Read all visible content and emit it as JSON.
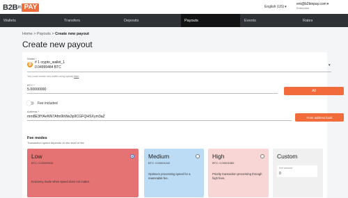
{
  "header": {
    "logo_text": "B2B",
    "logo_sub": "in",
    "logo_pay": "PAY",
    "language": "English (US)",
    "user_email": "ent@b2binpay.com",
    "user_role": "Enterprise"
  },
  "nav": {
    "items": [
      "Wallets",
      "Transfers",
      "Deposits",
      "Payouts",
      "Events",
      "Rates"
    ],
    "active": "Payouts"
  },
  "breadcrumb": {
    "home": "Home",
    "sep": ">",
    "payouts": "Payouts",
    "current": "Create new payout"
  },
  "page": {
    "title": "Create new payout"
  },
  "form": {
    "wallet_label": "Wallet *",
    "wallet_name": "# 1 crypto_wallet_1",
    "wallet_balance": "0.04999484 BTC",
    "wallet_hint": "You could create new wallet using special",
    "wallet_hint_link": "form",
    "amount_label": "BTC *",
    "amount_value": "5.00000000",
    "all_button": "All",
    "fee_included": "Fee included",
    "address_label": "Address *",
    "address_value": "mm8E3fYAeNN7Afm9bWa3p9CGFQHSXym3aZ",
    "address_book_button": "From address book"
  },
  "fee_modes": {
    "title": "Fee modes",
    "subtitle": "Transaction speed depends on the level of fee",
    "modes": [
      {
        "name": "Low",
        "fee": "BTC: 0.00000516",
        "desc": "Economy mode when speed does not matter.",
        "selected": true
      },
      {
        "name": "Medium",
        "fee": "BTC: 0.00001242",
        "desc": "Optimum processing speed for a reasonable fee.",
        "selected": false
      },
      {
        "name": "High",
        "fee": "BTC: 0.00001560",
        "desc": "Priority transaction processing through high fees.",
        "selected": false
      },
      {
        "name": "Custom",
        "fee_label": "Fee amount",
        "fee_value": "0"
      }
    ]
  },
  "colors": {
    "accent": "#f26b3a",
    "nav_bg": "#2e3136",
    "low": "#e57373",
    "medium": "#bcdcf6",
    "high": "#f8d6d6"
  },
  "icons": {
    "wallet": "bitcoin-icon",
    "dropdown": "chevron-down-icon"
  }
}
